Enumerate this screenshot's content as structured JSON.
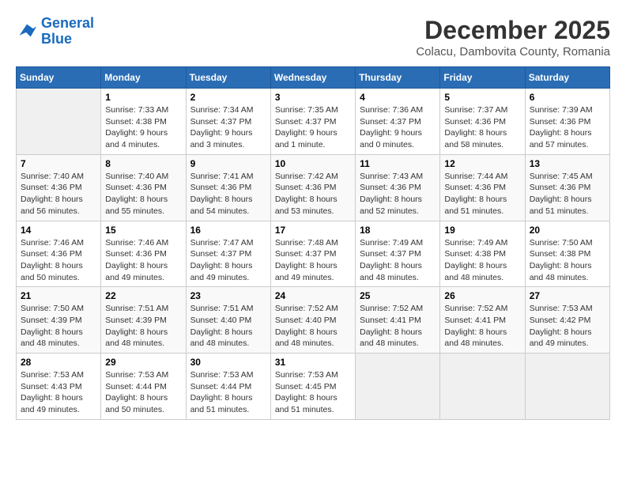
{
  "logo": {
    "line1": "General",
    "line2": "Blue"
  },
  "title": "December 2025",
  "subtitle": "Colacu, Dambovita County, Romania",
  "days_of_week": [
    "Sunday",
    "Monday",
    "Tuesday",
    "Wednesday",
    "Thursday",
    "Friday",
    "Saturday"
  ],
  "weeks": [
    [
      {
        "num": "",
        "info": ""
      },
      {
        "num": "1",
        "info": "Sunrise: 7:33 AM\nSunset: 4:38 PM\nDaylight: 9 hours\nand 4 minutes."
      },
      {
        "num": "2",
        "info": "Sunrise: 7:34 AM\nSunset: 4:37 PM\nDaylight: 9 hours\nand 3 minutes."
      },
      {
        "num": "3",
        "info": "Sunrise: 7:35 AM\nSunset: 4:37 PM\nDaylight: 9 hours\nand 1 minute."
      },
      {
        "num": "4",
        "info": "Sunrise: 7:36 AM\nSunset: 4:37 PM\nDaylight: 9 hours\nand 0 minutes."
      },
      {
        "num": "5",
        "info": "Sunrise: 7:37 AM\nSunset: 4:36 PM\nDaylight: 8 hours\nand 58 minutes."
      },
      {
        "num": "6",
        "info": "Sunrise: 7:39 AM\nSunset: 4:36 PM\nDaylight: 8 hours\nand 57 minutes."
      }
    ],
    [
      {
        "num": "7",
        "info": "Sunrise: 7:40 AM\nSunset: 4:36 PM\nDaylight: 8 hours\nand 56 minutes."
      },
      {
        "num": "8",
        "info": "Sunrise: 7:40 AM\nSunset: 4:36 PM\nDaylight: 8 hours\nand 55 minutes."
      },
      {
        "num": "9",
        "info": "Sunrise: 7:41 AM\nSunset: 4:36 PM\nDaylight: 8 hours\nand 54 minutes."
      },
      {
        "num": "10",
        "info": "Sunrise: 7:42 AM\nSunset: 4:36 PM\nDaylight: 8 hours\nand 53 minutes."
      },
      {
        "num": "11",
        "info": "Sunrise: 7:43 AM\nSunset: 4:36 PM\nDaylight: 8 hours\nand 52 minutes."
      },
      {
        "num": "12",
        "info": "Sunrise: 7:44 AM\nSunset: 4:36 PM\nDaylight: 8 hours\nand 51 minutes."
      },
      {
        "num": "13",
        "info": "Sunrise: 7:45 AM\nSunset: 4:36 PM\nDaylight: 8 hours\nand 51 minutes."
      }
    ],
    [
      {
        "num": "14",
        "info": "Sunrise: 7:46 AM\nSunset: 4:36 PM\nDaylight: 8 hours\nand 50 minutes."
      },
      {
        "num": "15",
        "info": "Sunrise: 7:46 AM\nSunset: 4:36 PM\nDaylight: 8 hours\nand 49 minutes."
      },
      {
        "num": "16",
        "info": "Sunrise: 7:47 AM\nSunset: 4:37 PM\nDaylight: 8 hours\nand 49 minutes."
      },
      {
        "num": "17",
        "info": "Sunrise: 7:48 AM\nSunset: 4:37 PM\nDaylight: 8 hours\nand 49 minutes."
      },
      {
        "num": "18",
        "info": "Sunrise: 7:49 AM\nSunset: 4:37 PM\nDaylight: 8 hours\nand 48 minutes."
      },
      {
        "num": "19",
        "info": "Sunrise: 7:49 AM\nSunset: 4:38 PM\nDaylight: 8 hours\nand 48 minutes."
      },
      {
        "num": "20",
        "info": "Sunrise: 7:50 AM\nSunset: 4:38 PM\nDaylight: 8 hours\nand 48 minutes."
      }
    ],
    [
      {
        "num": "21",
        "info": "Sunrise: 7:50 AM\nSunset: 4:39 PM\nDaylight: 8 hours\nand 48 minutes."
      },
      {
        "num": "22",
        "info": "Sunrise: 7:51 AM\nSunset: 4:39 PM\nDaylight: 8 hours\nand 48 minutes."
      },
      {
        "num": "23",
        "info": "Sunrise: 7:51 AM\nSunset: 4:40 PM\nDaylight: 8 hours\nand 48 minutes."
      },
      {
        "num": "24",
        "info": "Sunrise: 7:52 AM\nSunset: 4:40 PM\nDaylight: 8 hours\nand 48 minutes."
      },
      {
        "num": "25",
        "info": "Sunrise: 7:52 AM\nSunset: 4:41 PM\nDaylight: 8 hours\nand 48 minutes."
      },
      {
        "num": "26",
        "info": "Sunrise: 7:52 AM\nSunset: 4:41 PM\nDaylight: 8 hours\nand 48 minutes."
      },
      {
        "num": "27",
        "info": "Sunrise: 7:53 AM\nSunset: 4:42 PM\nDaylight: 8 hours\nand 49 minutes."
      }
    ],
    [
      {
        "num": "28",
        "info": "Sunrise: 7:53 AM\nSunset: 4:43 PM\nDaylight: 8 hours\nand 49 minutes."
      },
      {
        "num": "29",
        "info": "Sunrise: 7:53 AM\nSunset: 4:44 PM\nDaylight: 8 hours\nand 50 minutes."
      },
      {
        "num": "30",
        "info": "Sunrise: 7:53 AM\nSunset: 4:44 PM\nDaylight: 8 hours\nand 51 minutes."
      },
      {
        "num": "31",
        "info": "Sunrise: 7:53 AM\nSunset: 4:45 PM\nDaylight: 8 hours\nand 51 minutes."
      },
      {
        "num": "",
        "info": ""
      },
      {
        "num": "",
        "info": ""
      },
      {
        "num": "",
        "info": ""
      }
    ]
  ]
}
